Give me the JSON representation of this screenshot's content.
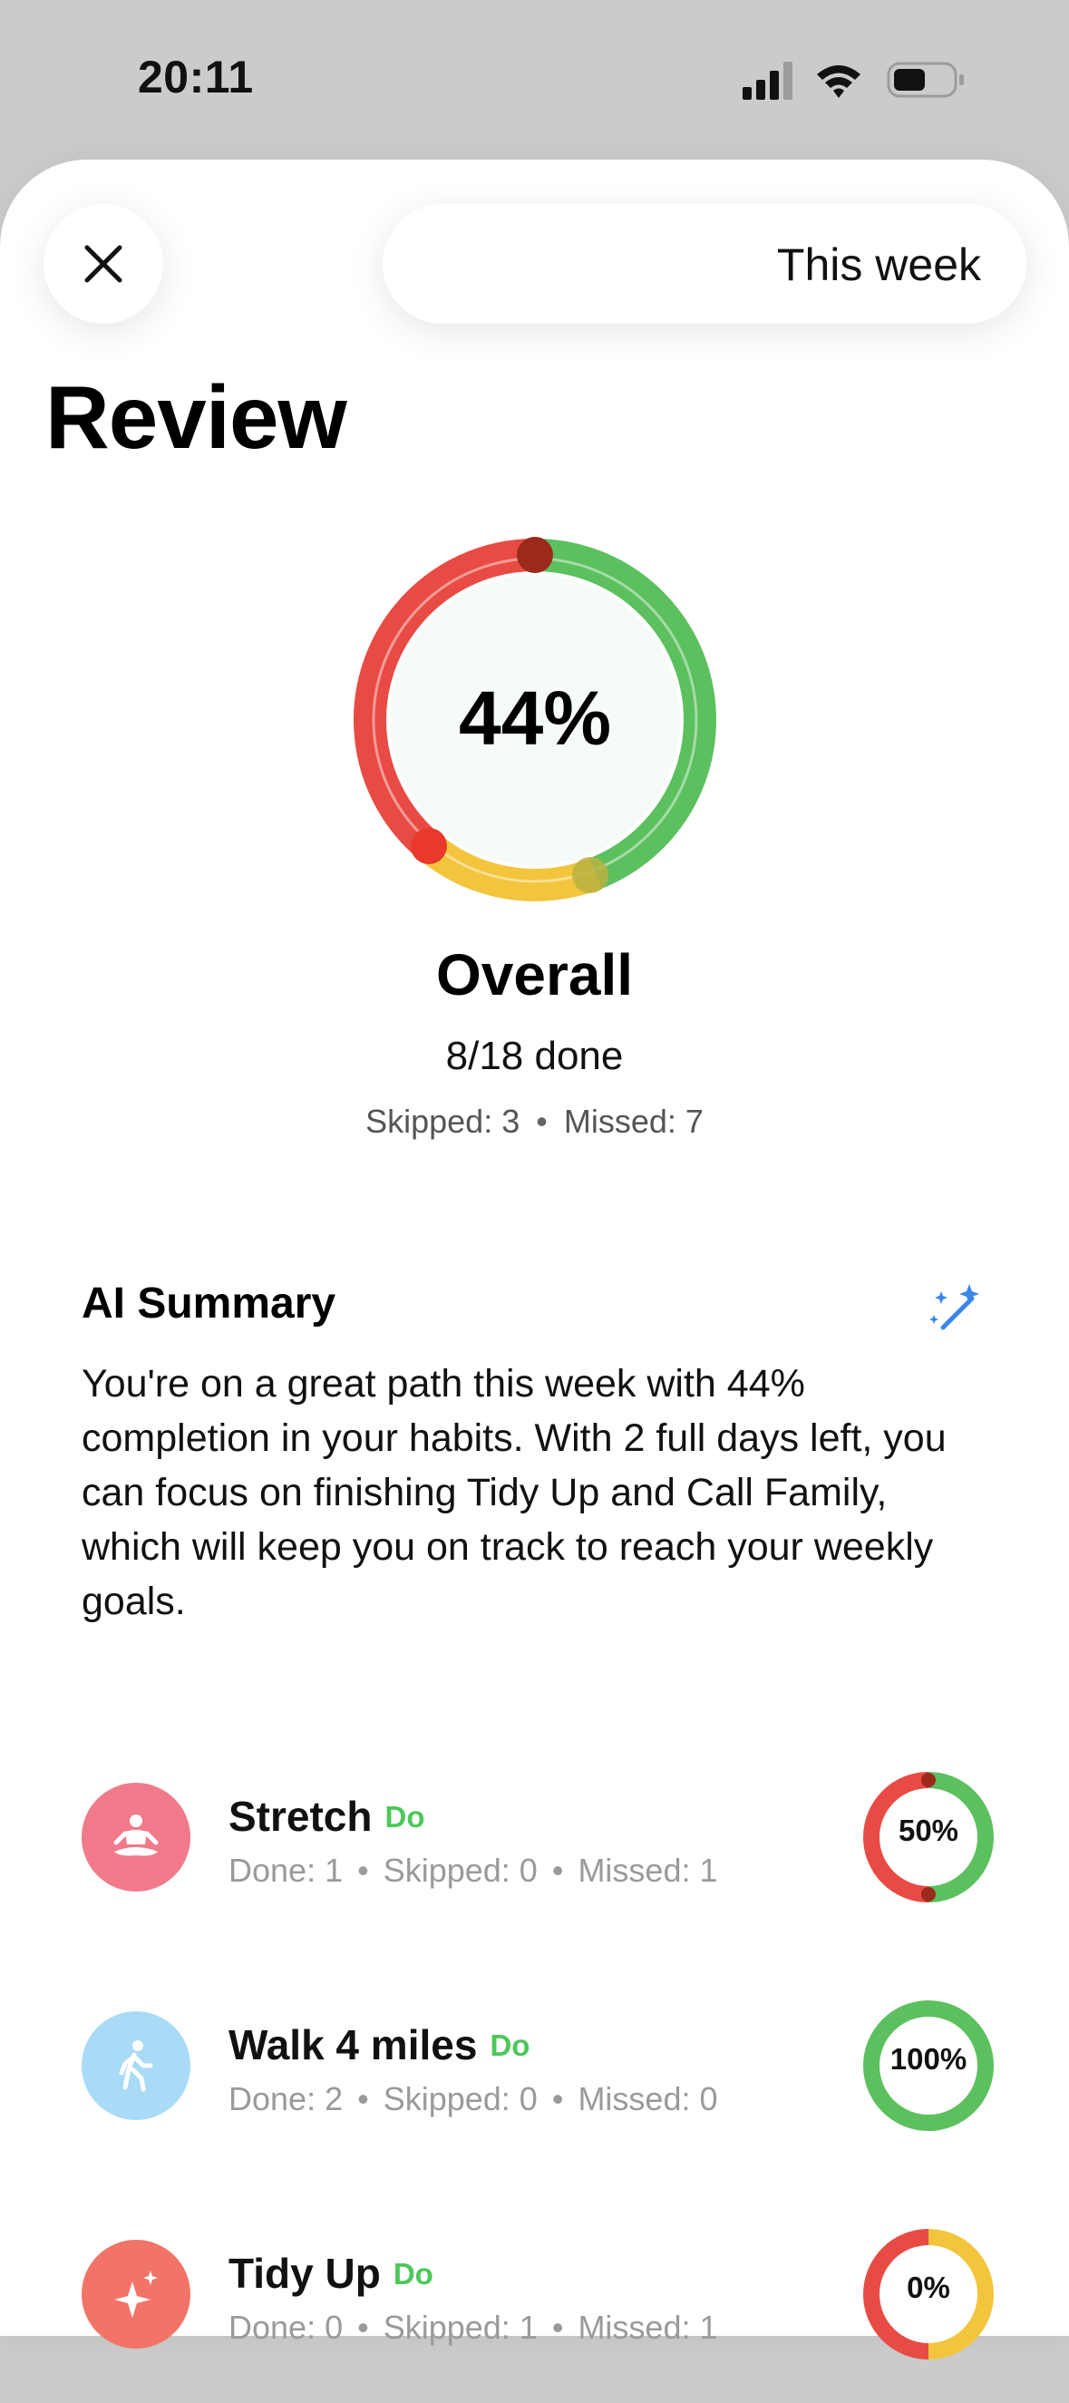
{
  "status_bar": {
    "time": "20:11"
  },
  "header": {
    "close_icon": "close-icon",
    "period": "This week"
  },
  "page": {
    "title": "Review"
  },
  "overall": {
    "percent_label": "44%",
    "percent": 44,
    "label": "Overall",
    "done_text": "8/18 done",
    "skipped_text": "Skipped: 3",
    "missed_text": "Missed: 7",
    "segments": {
      "green": 0.44,
      "yellow": 0.17,
      "red": 0.39
    },
    "colors": {
      "done": "#5cc05e",
      "skipped": "#f2c53d",
      "missed": "#e84b43"
    }
  },
  "ai_summary": {
    "title": "AI Summary",
    "icon": "magic-wand-icon",
    "text": "You're on a great path this week with 44% completion in your habits. With 2 full days left, you can focus on finishing Tidy Up and Call Family, which will keep you on track to reach your weekly goals."
  },
  "habits": [
    {
      "name": "Stretch",
      "tag": "Do",
      "icon": "meditation-icon",
      "avatar_color": "#f07a8a",
      "done": "Done: 1",
      "skipped": "Skipped: 0",
      "missed": "Missed: 1",
      "percent_label": "50%",
      "green": 0.5,
      "yellow": 0.0,
      "red": 0.5
    },
    {
      "name": "Walk 4 miles",
      "tag": "Do",
      "icon": "walking-icon",
      "avatar_color": "#a9daf6",
      "done": "Done: 2",
      "skipped": "Skipped: 0",
      "missed": "Missed: 0",
      "percent_label": "100%",
      "green": 1.0,
      "yellow": 0.0,
      "red": 0.0
    },
    {
      "name": "Tidy Up",
      "tag": "Do",
      "icon": "sparkle-icon",
      "avatar_color": "#f27468",
      "done": "Done: 0",
      "skipped": "Skipped: 1",
      "missed": "Missed: 1",
      "percent_label": "0%",
      "green": 0.0,
      "yellow": 0.5,
      "red": 0.5
    }
  ]
}
